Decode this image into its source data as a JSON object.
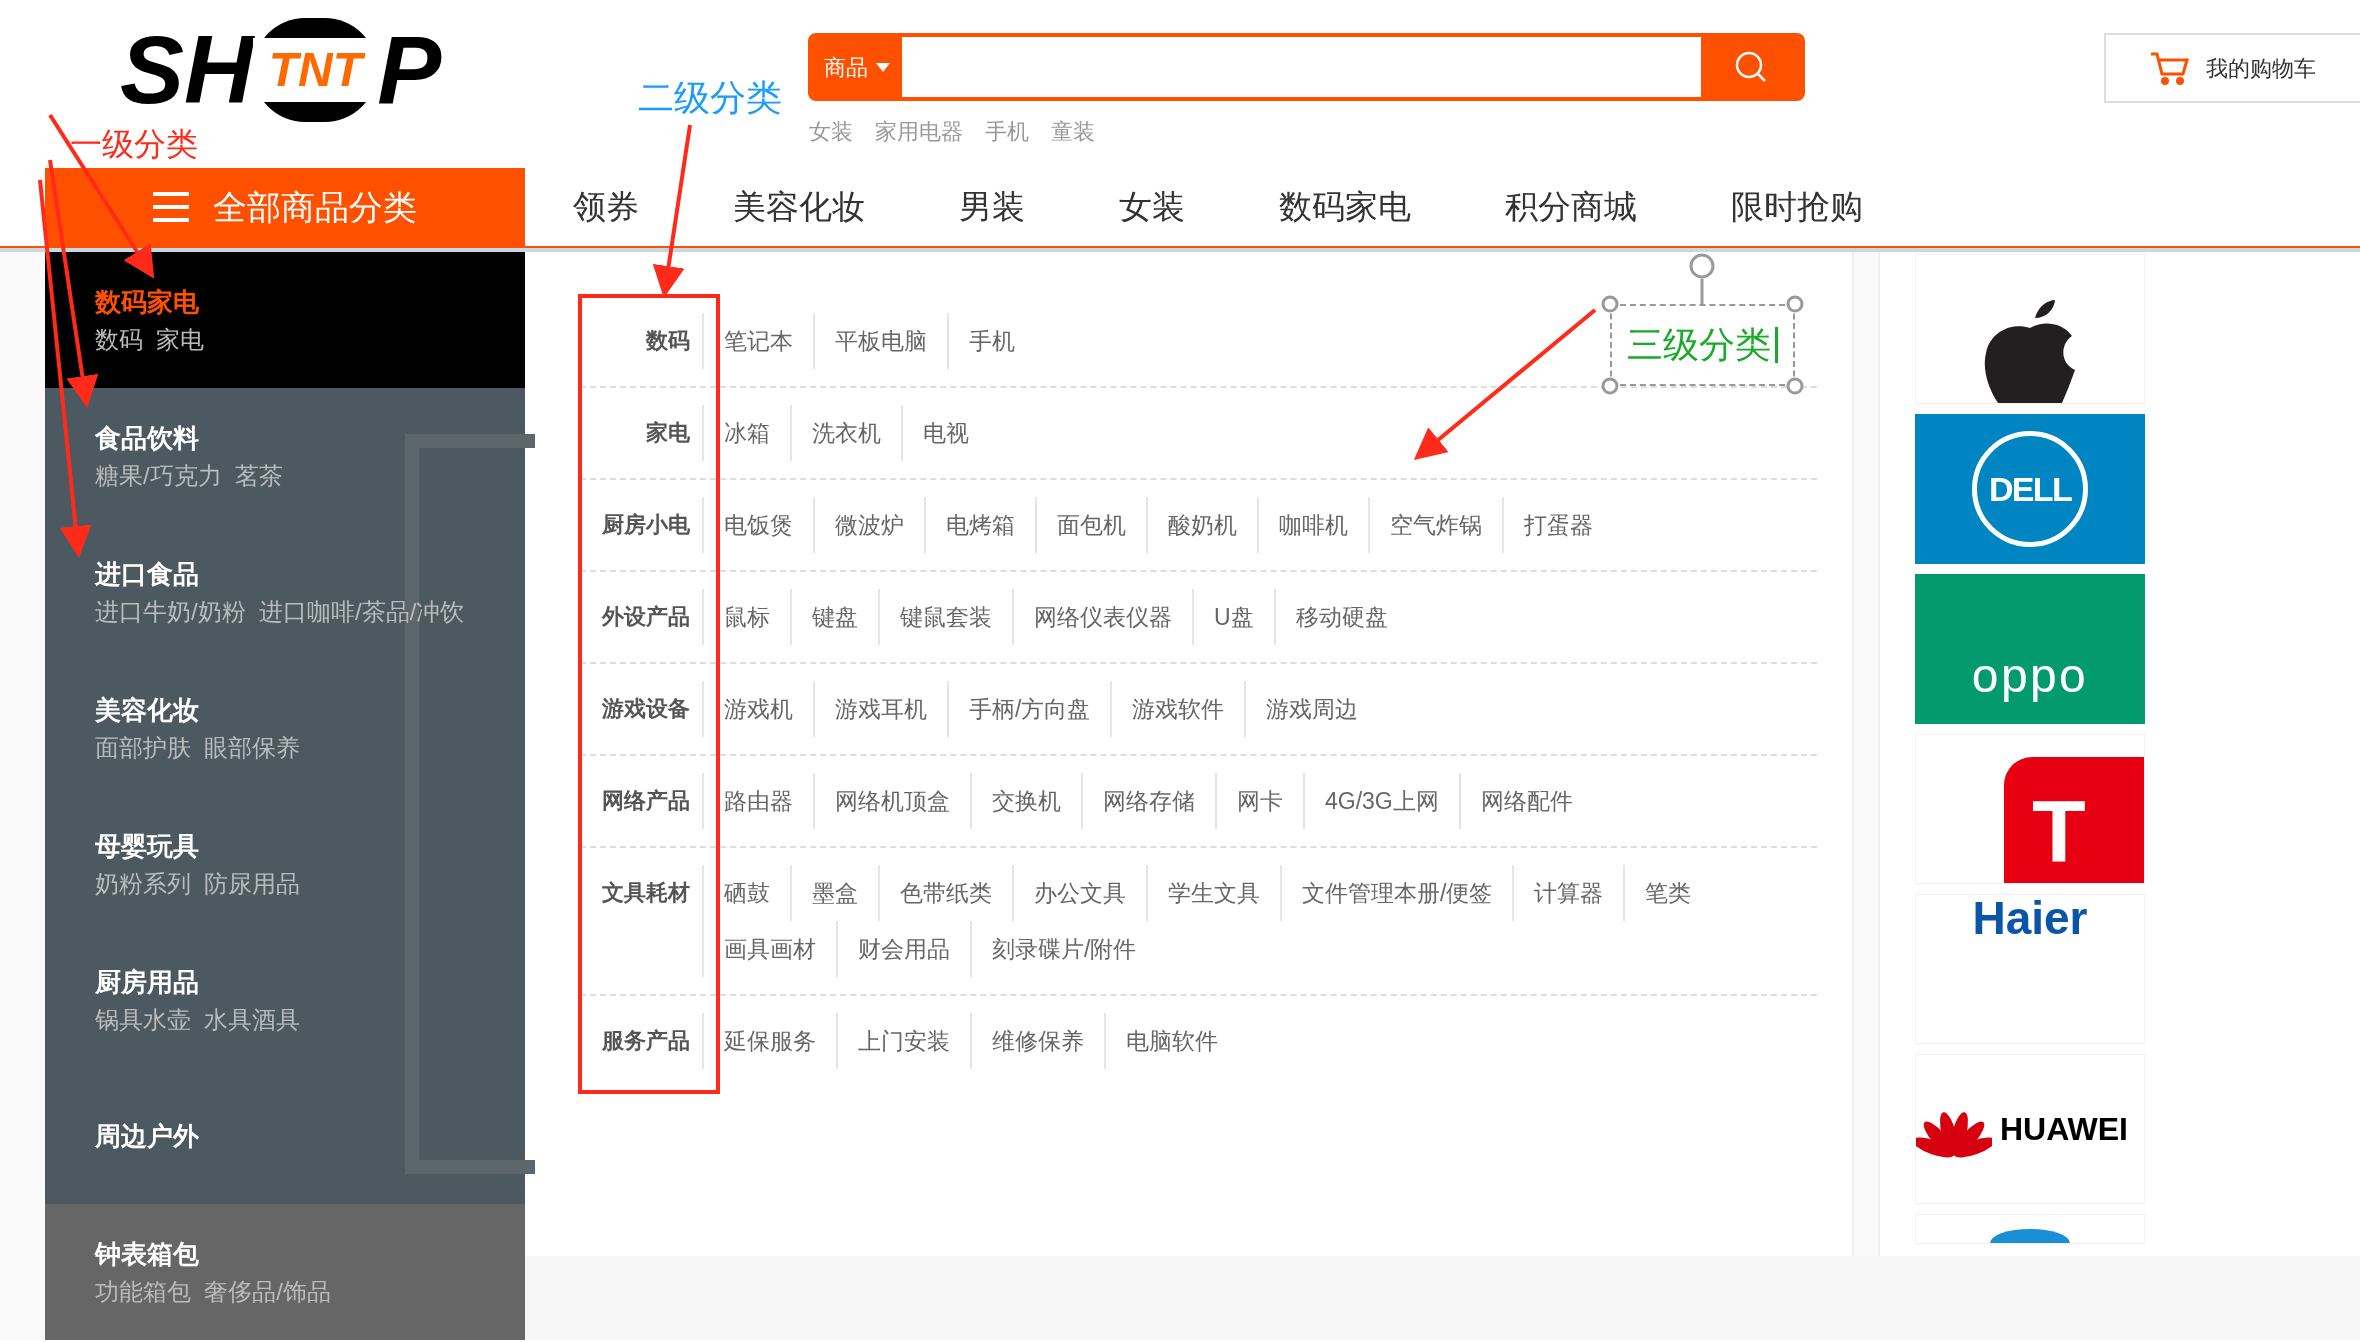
{
  "logo": {
    "left": "SH",
    "middle": "TNT",
    "right": "P"
  },
  "search": {
    "scope": "商品",
    "hot_words": [
      "女装",
      "家用电器",
      "手机",
      "童装"
    ]
  },
  "cart": {
    "label": "我的购物车"
  },
  "all_categories": {
    "label": "全部商品分类"
  },
  "nav": [
    "领券",
    "美容化妆",
    "男装",
    "女装",
    "数码家电",
    "积分商城",
    "限时抢购"
  ],
  "sidebar": [
    {
      "title": "数码家电",
      "subtitle": "数码  家电",
      "selected": true
    },
    {
      "title": "食品饮料",
      "subtitle": "糖果/巧克力  茗茶",
      "selected": false
    },
    {
      "title": "进口食品",
      "subtitle": "进口牛奶/奶粉  进口咖啡/茶品/冲饮",
      "selected": false
    },
    {
      "title": "美容化妆",
      "subtitle": "面部护肤  眼部保养",
      "selected": false
    },
    {
      "title": "母婴玩具",
      "subtitle": "奶粉系列  防尿用品",
      "selected": false
    },
    {
      "title": "厨房用品",
      "subtitle": "锅具水壶  水具酒具",
      "selected": false
    },
    {
      "title": "周边户外",
      "selected": false
    },
    {
      "title": "钟表箱包",
      "subtitle": "功能箱包  奢侈品/饰品",
      "selected": false
    }
  ],
  "menu": [
    {
      "label": "数码",
      "items": [
        "笔记本",
        "平板电脑",
        "手机"
      ]
    },
    {
      "label": "家电",
      "items": [
        "冰箱",
        "洗衣机",
        "电视"
      ]
    },
    {
      "label": "厨房小电",
      "items": [
        "电饭煲",
        "微波炉",
        "电烤箱",
        "面包机",
        "酸奶机",
        "咖啡机",
        "空气炸锅",
        "打蛋器"
      ]
    },
    {
      "label": "外设产品",
      "items": [
        "鼠标",
        "键盘",
        "键鼠套装",
        "网络仪表仪器",
        "U盘",
        "移动硬盘"
      ]
    },
    {
      "label": "游戏设备",
      "items": [
        "游戏机",
        "游戏耳机",
        "手柄/方向盘",
        "游戏软件",
        "游戏周边"
      ]
    },
    {
      "label": "网络产品",
      "items": [
        "路由器",
        "网络机顶盒",
        "交换机",
        "网络存储",
        "网卡",
        "4G/3G上网",
        "网络配件"
      ]
    },
    {
      "label": "文具耗材",
      "items": [
        "硒鼓",
        "墨盒",
        "色带纸类",
        "办公文具",
        "学生文具",
        "文件管理本册/便签",
        "计算器",
        "笔类",
        "画具画材",
        "财会用品",
        "刻录碟片/附件"
      ]
    },
    {
      "label": "服务产品",
      "items": [
        "延保服务",
        "上门安装",
        "维修保养",
        "电脑软件"
      ]
    }
  ],
  "brands": [
    {
      "kind": "apple"
    },
    {
      "kind": "dell",
      "text": "DELL"
    },
    {
      "kind": "oppo",
      "text": "oppo"
    },
    {
      "kind": "tcl",
      "text": "T"
    },
    {
      "kind": "haier",
      "text": "Haier"
    },
    {
      "kind": "huawei",
      "text": "HUAWEI"
    },
    {
      "kind": "partial"
    }
  ],
  "annotations": [
    {
      "kind": "level1",
      "text": "一级分类",
      "color": "#ff2a1a"
    },
    {
      "kind": "level2",
      "text": "二级分类",
      "color": "#1a9bff"
    },
    {
      "kind": "level3",
      "text": "三级分类",
      "color": "#1aaa2a"
    }
  ]
}
